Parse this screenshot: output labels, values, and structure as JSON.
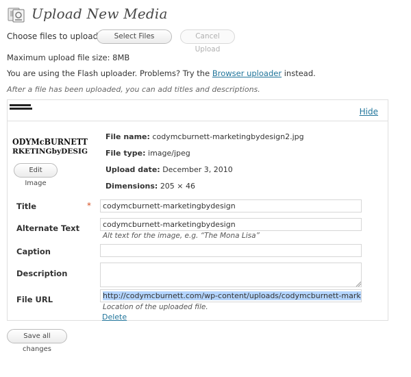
{
  "header": {
    "title": "Upload New Media"
  },
  "uploader": {
    "choose_label": "Choose files to upload",
    "select_files": "Select Files",
    "cancel_upload": "Cancel Upload",
    "max_size": "Maximum upload file size: 8MB",
    "flash_prefix": "You are using the Flash uploader. Problems? Try the",
    "browser_link": "Browser uploader",
    "flash_suffix": "instead.",
    "after_note": "After a file has been uploaded, you can add titles and descriptions."
  },
  "item": {
    "hide": "Hide",
    "edit_image": "Edit Image",
    "file_name_label": "File name:",
    "file_name": "codymcburnett-marketingbydesign2.jpg",
    "file_type_label": "File type:",
    "file_type": "image/jpeg",
    "upload_date_label": "Upload date:",
    "upload_date": "December 3, 2010",
    "dimensions_label": "Dimensions:",
    "dimensions": "205 × 46",
    "thumb_line1": "ODYMcBURNETT",
    "thumb_line2": "RKETINGbyDESIG",
    "fields": {
      "title_label": "Title",
      "required": "*",
      "title_value": "codymcburnett-marketingbydesign",
      "alt_label": "Alternate Text",
      "alt_value": "codymcburnett-marketingbydesign",
      "alt_help": "Alt text for the image, e.g. “The Mona Lisa”",
      "caption_label": "Caption",
      "caption_value": "",
      "description_label": "Description",
      "description_value": "",
      "url_label": "File URL",
      "url_value": "http://codymcburnett.com/wp-content/uploads/codymcburnett-marketingb",
      "url_help": "Location of the uploaded file.",
      "delete": "Delete"
    }
  },
  "footer": {
    "save_all": "Save all changes"
  }
}
